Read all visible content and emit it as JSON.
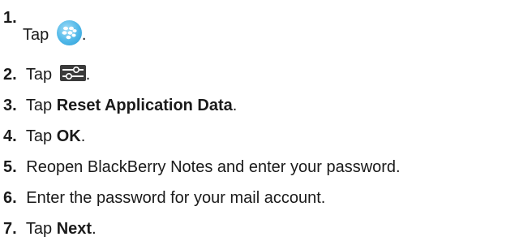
{
  "steps": [
    {
      "number": "1.",
      "pre": "Tap",
      "icon": "blackberry-hub-icon",
      "post": "."
    },
    {
      "number": "2.",
      "pre": "Tap",
      "icon": "settings-sliders-icon",
      "post": "."
    },
    {
      "number": "3.",
      "pre": "Tap",
      "bold": "Reset Application Data",
      "post": "."
    },
    {
      "number": "4.",
      "pre": "Tap",
      "bold": "OK",
      "post": "."
    },
    {
      "number": "5.",
      "text": "Reopen BlackBerry Notes and enter your password."
    },
    {
      "number": "6.",
      "text": "Enter the password for your mail account."
    },
    {
      "number": "7.",
      "pre": "Tap",
      "bold": "Next",
      "post": "."
    }
  ]
}
